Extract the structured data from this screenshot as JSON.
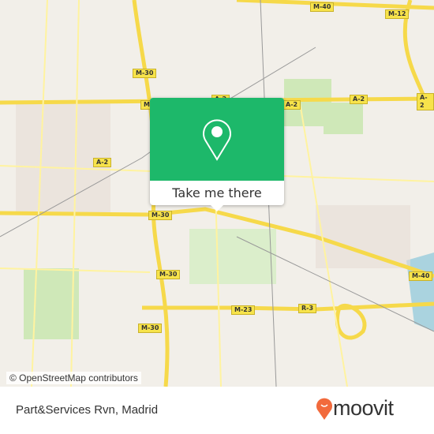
{
  "map": {
    "road_labels": [
      "M-40",
      "M-12",
      "M-30",
      "M-30",
      "A-2",
      "A-2",
      "A-2",
      "A-2",
      "M-30",
      "M-30",
      "M-30",
      "M-23",
      "R-3",
      "M-40",
      "A-2"
    ],
    "attribution": "© OpenStreetMap contributors"
  },
  "popup": {
    "button_label": "Take me there",
    "icon": "map-pin-icon",
    "color": "#1db86a"
  },
  "footer": {
    "place_name": "Part&Services Rvn, Madrid",
    "logo_text": "moovit",
    "logo_color": "#f26a3c"
  }
}
